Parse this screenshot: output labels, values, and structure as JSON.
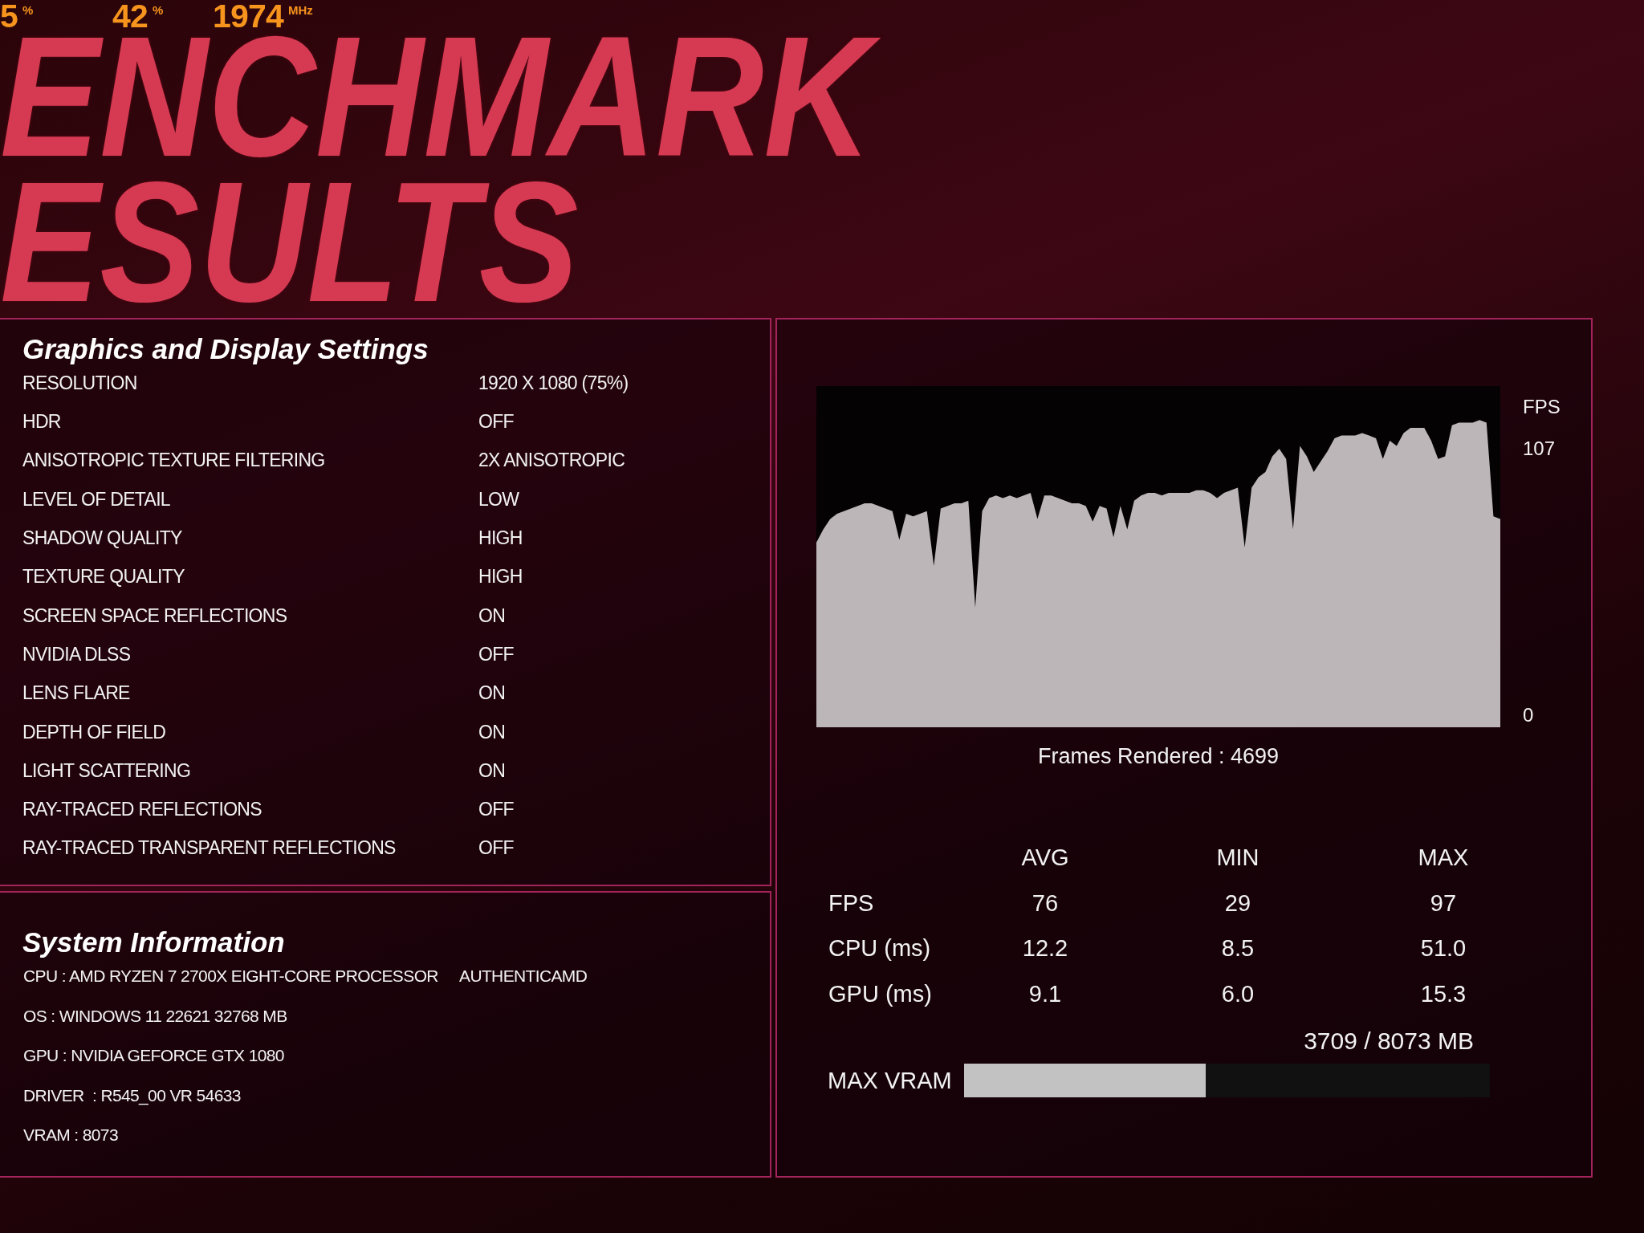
{
  "overlay": {
    "readings": [
      {
        "value": "5",
        "unit": "%"
      },
      {
        "value": "42",
        "unit": "%"
      },
      {
        "value": "1974",
        "unit": "MHz"
      }
    ]
  },
  "title": {
    "lines": [
      "ENCHMARK",
      "ESULTS"
    ]
  },
  "graphics_settings": {
    "heading": "Graphics and Display Settings",
    "rows": [
      {
        "label": "RESOLUTION",
        "value": "1920 X 1080 (75%)"
      },
      {
        "label": "HDR",
        "value": "OFF"
      },
      {
        "label": "ANISOTROPIC TEXTURE FILTERING",
        "value": "2X ANISOTROPIC"
      },
      {
        "label": "LEVEL OF DETAIL",
        "value": "LOW"
      },
      {
        "label": "SHADOW QUALITY",
        "value": "HIGH"
      },
      {
        "label": "TEXTURE QUALITY",
        "value": "HIGH"
      },
      {
        "label": "SCREEN SPACE REFLECTIONS",
        "value": "ON"
      },
      {
        "label": "NVIDIA DLSS",
        "value": "OFF"
      },
      {
        "label": "LENS FLARE",
        "value": "ON"
      },
      {
        "label": "DEPTH OF FIELD",
        "value": "ON"
      },
      {
        "label": "LIGHT SCATTERING",
        "value": "ON"
      },
      {
        "label": "RAY-TRACED REFLECTIONS",
        "value": "OFF"
      },
      {
        "label": "RAY-TRACED TRANSPARENT REFLECTIONS",
        "value": "OFF"
      }
    ]
  },
  "system_information": {
    "heading": "System Information",
    "rows": [
      {
        "text": "CPU : AMD RYZEN 7 2700X EIGHT-CORE PROCESSOR",
        "vendor": "AUTHENTICAMD"
      },
      {
        "text": "OS : WINDOWS 11 22621 32768 MB"
      },
      {
        "text": "GPU : NVIDIA GEFORCE GTX 1080"
      },
      {
        "text": "DRIVER  : R545_00 VR 54633"
      },
      {
        "text": "VRAM : 8073"
      }
    ]
  },
  "performance": {
    "graph": {
      "axis_title": "FPS",
      "top_label": "107",
      "bottom_label": "0"
    },
    "frames_rendered": "Frames Rendered : 4699",
    "stats": {
      "columns": [
        "AVG",
        "MIN",
        "MAX"
      ],
      "rows": [
        {
          "label": "FPS",
          "values": [
            "76",
            "29",
            "97"
          ]
        },
        {
          "label": "CPU (ms)",
          "values": [
            "12.2",
            "8.5",
            "51.0"
          ]
        },
        {
          "label": "GPU (ms)",
          "values": [
            "9.1",
            "6.0",
            "15.3"
          ]
        }
      ]
    },
    "vram": {
      "reading": "3709 / 8073 MB",
      "label": "MAX VRAM",
      "level": 0.459
    }
  }
}
